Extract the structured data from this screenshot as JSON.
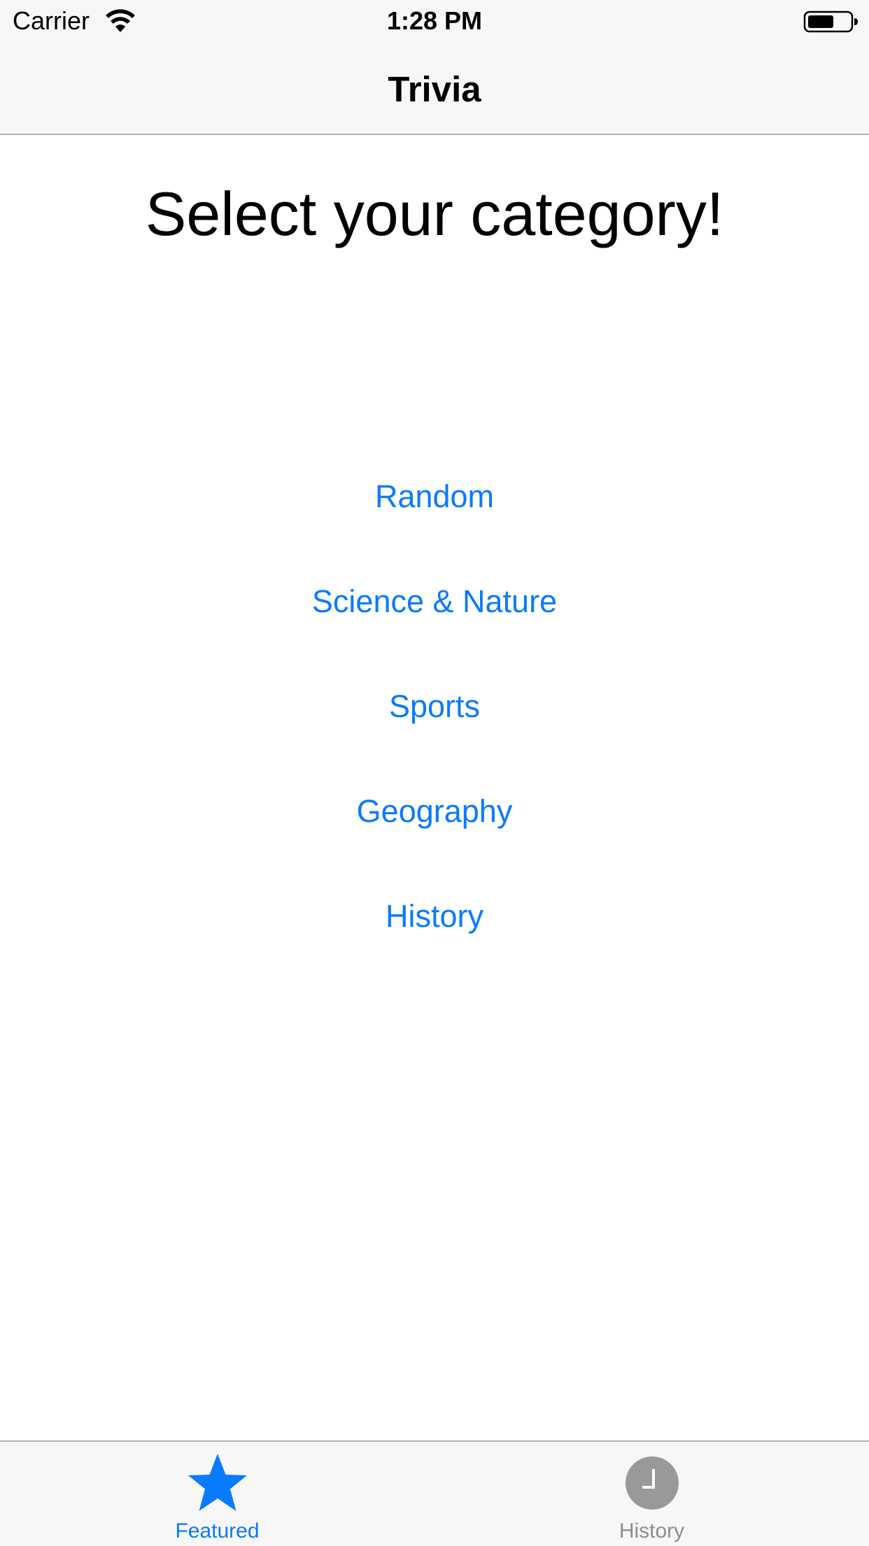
{
  "status_bar": {
    "carrier": "Carrier",
    "time": "1:28 PM",
    "icons": [
      "wifi-icon",
      "battery-icon"
    ]
  },
  "nav_bar": {
    "title": "Trivia"
  },
  "main": {
    "headline": "Select your category!",
    "categories": [
      {
        "label": "Random"
      },
      {
        "label": "Science & Nature"
      },
      {
        "label": "Sports"
      },
      {
        "label": "Geography"
      },
      {
        "label": "History"
      }
    ]
  },
  "tab_bar": {
    "tabs": [
      {
        "label": "Featured",
        "icon": "star-icon",
        "selected": true
      },
      {
        "label": "History",
        "icon": "clock-icon",
        "selected": false
      }
    ]
  },
  "colors": {
    "accent": "#0a7aff",
    "inactive": "#8e8e93",
    "bar_background": "#f7f7f7",
    "separator": "#b2b2b2"
  }
}
